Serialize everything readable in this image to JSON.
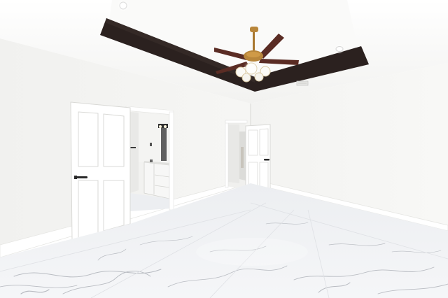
{
  "scene": {
    "subject": "empty-bedroom-interior",
    "colors": {
      "wall_light": "#f5f5f3",
      "wall_mid": "#eeeeec",
      "wall_shadow": "#e4e4e1",
      "ceiling": "#fbfbfa",
      "tray_band": "#2b211f",
      "floor_base": "#eeeff1",
      "floor_vein": "#b9bcc2",
      "door_white": "#ffffff",
      "door_panel_line": "#dadad7",
      "fan_brass": "#b8863b",
      "fan_blade": "#5a2c24",
      "vanity_white": "#f7f7f6",
      "mirror_dark": "#3a3a3a"
    },
    "icons": [
      "ceiling-fan-icon",
      "recessed-light-icon",
      "door-lever-icon",
      "air-vent-icon"
    ]
  }
}
